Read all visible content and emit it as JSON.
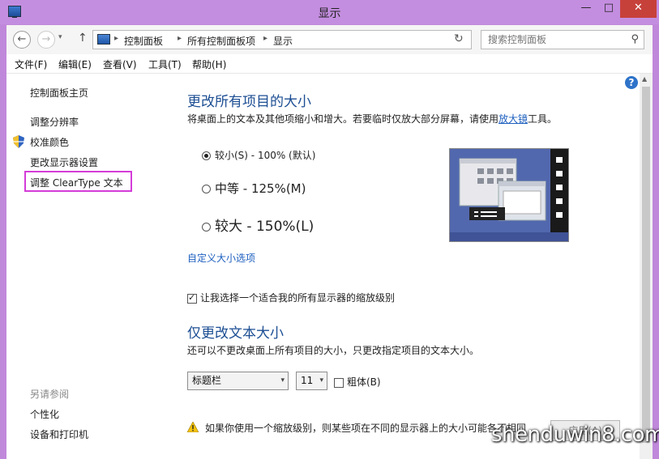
{
  "window": {
    "title": "显示"
  },
  "address": {
    "crumbs": [
      "控制面板",
      "所有控制面板项",
      "显示"
    ],
    "search_placeholder": "搜索控制面板"
  },
  "menu": [
    "文件(F)",
    "编辑(E)",
    "查看(V)",
    "工具(T)",
    "帮助(H)"
  ],
  "sidebar": {
    "home": "控制面板主页",
    "links": [
      "调整分辨率",
      "校准颜色",
      "更改显示器设置",
      "调整 ClearType 文本"
    ],
    "see_also_title": "另请参阅",
    "see_also": [
      "个性化",
      "设备和打印机"
    ]
  },
  "main": {
    "heading": "更改所有项目的大小",
    "description_pre": "将桌面上的文本及其他项缩小和增大。若要临时仅放大部分屏幕，请使用",
    "description_link": "放大镜",
    "description_post": "工具。",
    "options": [
      {
        "label": "较小(S) - 100% (默认)",
        "selected": true
      },
      {
        "label": "中等 - 125%(M)",
        "selected": false
      },
      {
        "label": "较大 - 150%(L)",
        "selected": false
      }
    ],
    "custom_link": "自定义大小选项",
    "scaling_checkbox": {
      "label": "让我选择一个适合我的所有显示器的缩放级别",
      "checked": true
    },
    "heading2": "仅更改文本大小",
    "description2": "还可以不更改桌面上所有项目的大小，只更改指定项目的文本大小。",
    "item_select": "标题栏",
    "size_select": "11",
    "bold_checkbox": {
      "label": "粗体(B)",
      "checked": false
    },
    "warning": "如果你使用一个缩放级别，则某些项在不同的显示器上的大小可能各不相同",
    "apply_label": "应用(A)"
  },
  "icons": {
    "back": "←",
    "forward": "→",
    "up": "↑",
    "dropdown": "▾",
    "separator": "▸",
    "refresh": "↻",
    "search": "⚲",
    "help": "?",
    "min": "—",
    "max": "□",
    "close": "✕"
  },
  "watermark": "shenduwin8.com"
}
